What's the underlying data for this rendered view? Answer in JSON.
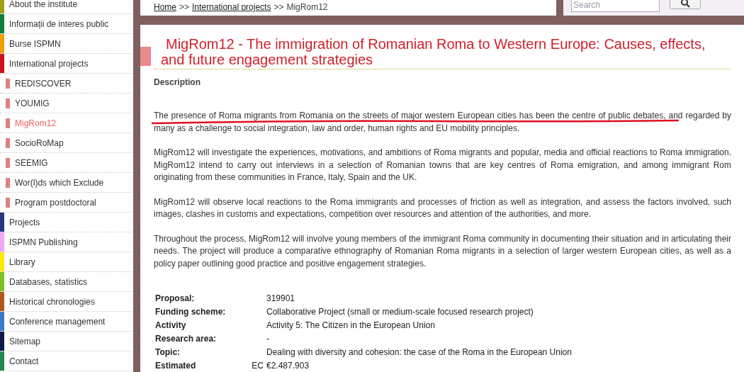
{
  "sidebar": {
    "items": [
      {
        "label": "About the institute",
        "color": "#a0a010",
        "selected": false
      },
      {
        "label": "Informații de interes public",
        "color": "#0a7d3a",
        "selected": false
      },
      {
        "label": "Burse ISPMN",
        "color": "#f0a000",
        "selected": false
      },
      {
        "label": "International projects",
        "color": "#d0101a",
        "selected": false,
        "children": [
          {
            "label": "REDISCOVER",
            "selected": false
          },
          {
            "label": "YOUMIG",
            "selected": false
          },
          {
            "label": "MigRom12",
            "selected": true
          },
          {
            "label": "SocioRoMap",
            "selected": false
          },
          {
            "label": "SEEMIG",
            "selected": false
          },
          {
            "label": "Wor(l)ds which Exclude",
            "selected": false
          },
          {
            "label": "Program postdoctoral",
            "selected": false
          }
        ]
      },
      {
        "label": "Projects",
        "color": "#2a3580",
        "selected": false
      },
      {
        "label": "ISPMN Publishing",
        "color": "#f0a8f0",
        "selected": false
      },
      {
        "label": "Library",
        "color": "#ffe800",
        "selected": false
      },
      {
        "label": "Databases, statistics",
        "color": "#80c020",
        "selected": false
      },
      {
        "label": "Historical chronologies",
        "color": "#b05820",
        "selected": false
      },
      {
        "label": "Conference management",
        "color": "#3a78c8",
        "selected": false
      },
      {
        "label": "Sitemap",
        "color": "#101848",
        "selected": false
      },
      {
        "label": "Contact",
        "color": "#208850",
        "selected": false
      }
    ]
  },
  "breadcrumb": [
    {
      "label": "Home",
      "link": true
    },
    {
      "label": ">>",
      "link": false
    },
    {
      "label": "International projects",
      "link": true
    },
    {
      "label": ">>",
      "link": false
    },
    {
      "label": "MigRom12",
      "link": false
    }
  ],
  "search": {
    "placeholder": "Search"
  },
  "title": "MigRom12 - The immigration of Romanian Roma to Western Europe: Causes, effects, and future engagement strategies",
  "section": "Description",
  "paragraphs": [
    {
      "text": "The presence of Roma migrants from Romania on the streets of major western European cities has been the centre of public debates, and regarded by many as a challenge to social integration, law and order, human rights and EU mobility principles.",
      "underlined": true
    },
    {
      "text": "MigRom12 will investigate the experiences, motivations, and ambitions of Roma migrants and popular, media and official reactions to Roma immigration. MigRom12 intend to carry out interviews in a selection of Romanian towns that are key centres of Roma emigration, and among immigrant Rom originating from these communities in France, Italy, Spain and the UK.",
      "underlined": false
    },
    {
      "text": "MigRom12 will observe local reactions to the Roma immigrants and processes of friction as well as integration, and assess the factors involved, such images, clashes in customs and expectations, competition over resources and attention of the authorities, and more.",
      "underlined": false
    },
    {
      "text": "Throughout the process, MigRom12 will involve young members of the immigrant Roma community in documenting their situation and in articulating their needs. The project will produce a comparative ethnography of Romanian Roma migrants in a selection of larger western European cities, as well as a policy paper outlining good practice and positive engagement strategies.",
      "underlined": false
    }
  ],
  "details": [
    {
      "label": "Proposal:",
      "value": "319901"
    },
    {
      "label": "Funding scheme:",
      "value": "Collaborative Project (small or medium-scale focused research project)"
    },
    {
      "label": "Activity",
      "value": "Activity 5: The Citizen in the European Union"
    },
    {
      "label": "Research area:",
      "value": "-"
    },
    {
      "label": "Topic:",
      "value": "Dealing with diversity and cohesion: the case of the Roma in the European Union"
    },
    {
      "label": "Estimated",
      "prefix": "EC",
      "value": "€2.487.903"
    }
  ]
}
